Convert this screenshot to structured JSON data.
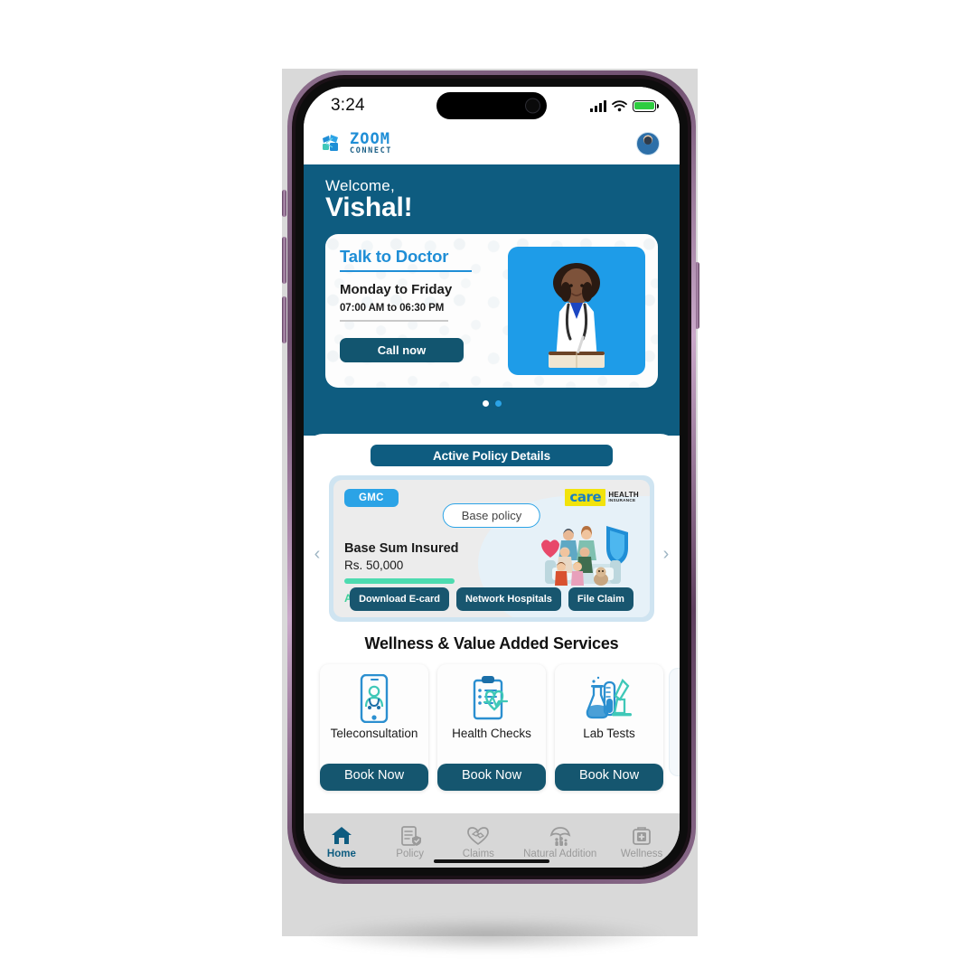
{
  "status_bar": {
    "time": "3:24",
    "signal_icon": "cellular-signal-icon",
    "wifi_icon": "wifi-icon",
    "battery_icon": "battery-icon"
  },
  "app_header": {
    "logo_primary": "ZOOM",
    "logo_secondary": "CONNECT",
    "avatar_icon": "user-avatar-icon"
  },
  "hero": {
    "welcome_label": "Welcome,",
    "user_name": "Vishal!",
    "doctor_card": {
      "title": "Talk to Doctor",
      "days": "Monday to Friday",
      "hours": "07:00 AM to 06:30 PM",
      "cta_label": "Call now",
      "photo_alt": "doctor-photo"
    },
    "carousel": {
      "total_dots": 2,
      "active_index": 0
    }
  },
  "policy": {
    "section_pill": "Active Policy Details",
    "prev_arrow_icon": "chevron-left-icon",
    "next_arrow_icon": "chevron-right-icon",
    "badge": "GMC",
    "type_pill": "Base policy",
    "insurer": {
      "mark": "care",
      "line1": "HEALTH",
      "line2": "INSURANCE"
    },
    "sum_label": "Base Sum Insured",
    "sum_value": "Rs. 50,000",
    "status": "Active",
    "status_asterisk": "*",
    "illustration": "family-protection-illustration",
    "actions": [
      "Download E-card",
      "Network Hospitals",
      "File Claim"
    ]
  },
  "wellness": {
    "section_title": "Wellness & Value Added Services",
    "cards": [
      {
        "label": "Teleconsultation",
        "icon": "teleconsultation-icon",
        "cta": "Book Now"
      },
      {
        "label": "Health Checks",
        "icon": "health-checks-icon",
        "cta": "Book Now"
      },
      {
        "label": "Lab Tests",
        "icon": "lab-tests-icon",
        "cta": "Book Now"
      }
    ]
  },
  "bottom_nav": {
    "items": [
      {
        "label": "Home",
        "icon": "home-icon",
        "active": true
      },
      {
        "label": "Policy",
        "icon": "policy-document-icon",
        "active": false
      },
      {
        "label": "Claims",
        "icon": "claims-handshake-icon",
        "active": false
      },
      {
        "label": "Natural Addition",
        "icon": "umbrella-family-icon",
        "active": false
      },
      {
        "label": "Wellness",
        "icon": "medical-kit-icon",
        "active": false
      }
    ]
  },
  "colors": {
    "brand_teal": "#0e5c80",
    "brand_blue": "#2ba3e6",
    "accent_green": "#3fd19a",
    "insurer_yellow": "#f2e30c",
    "nav_bar": "#d7d7d7"
  }
}
